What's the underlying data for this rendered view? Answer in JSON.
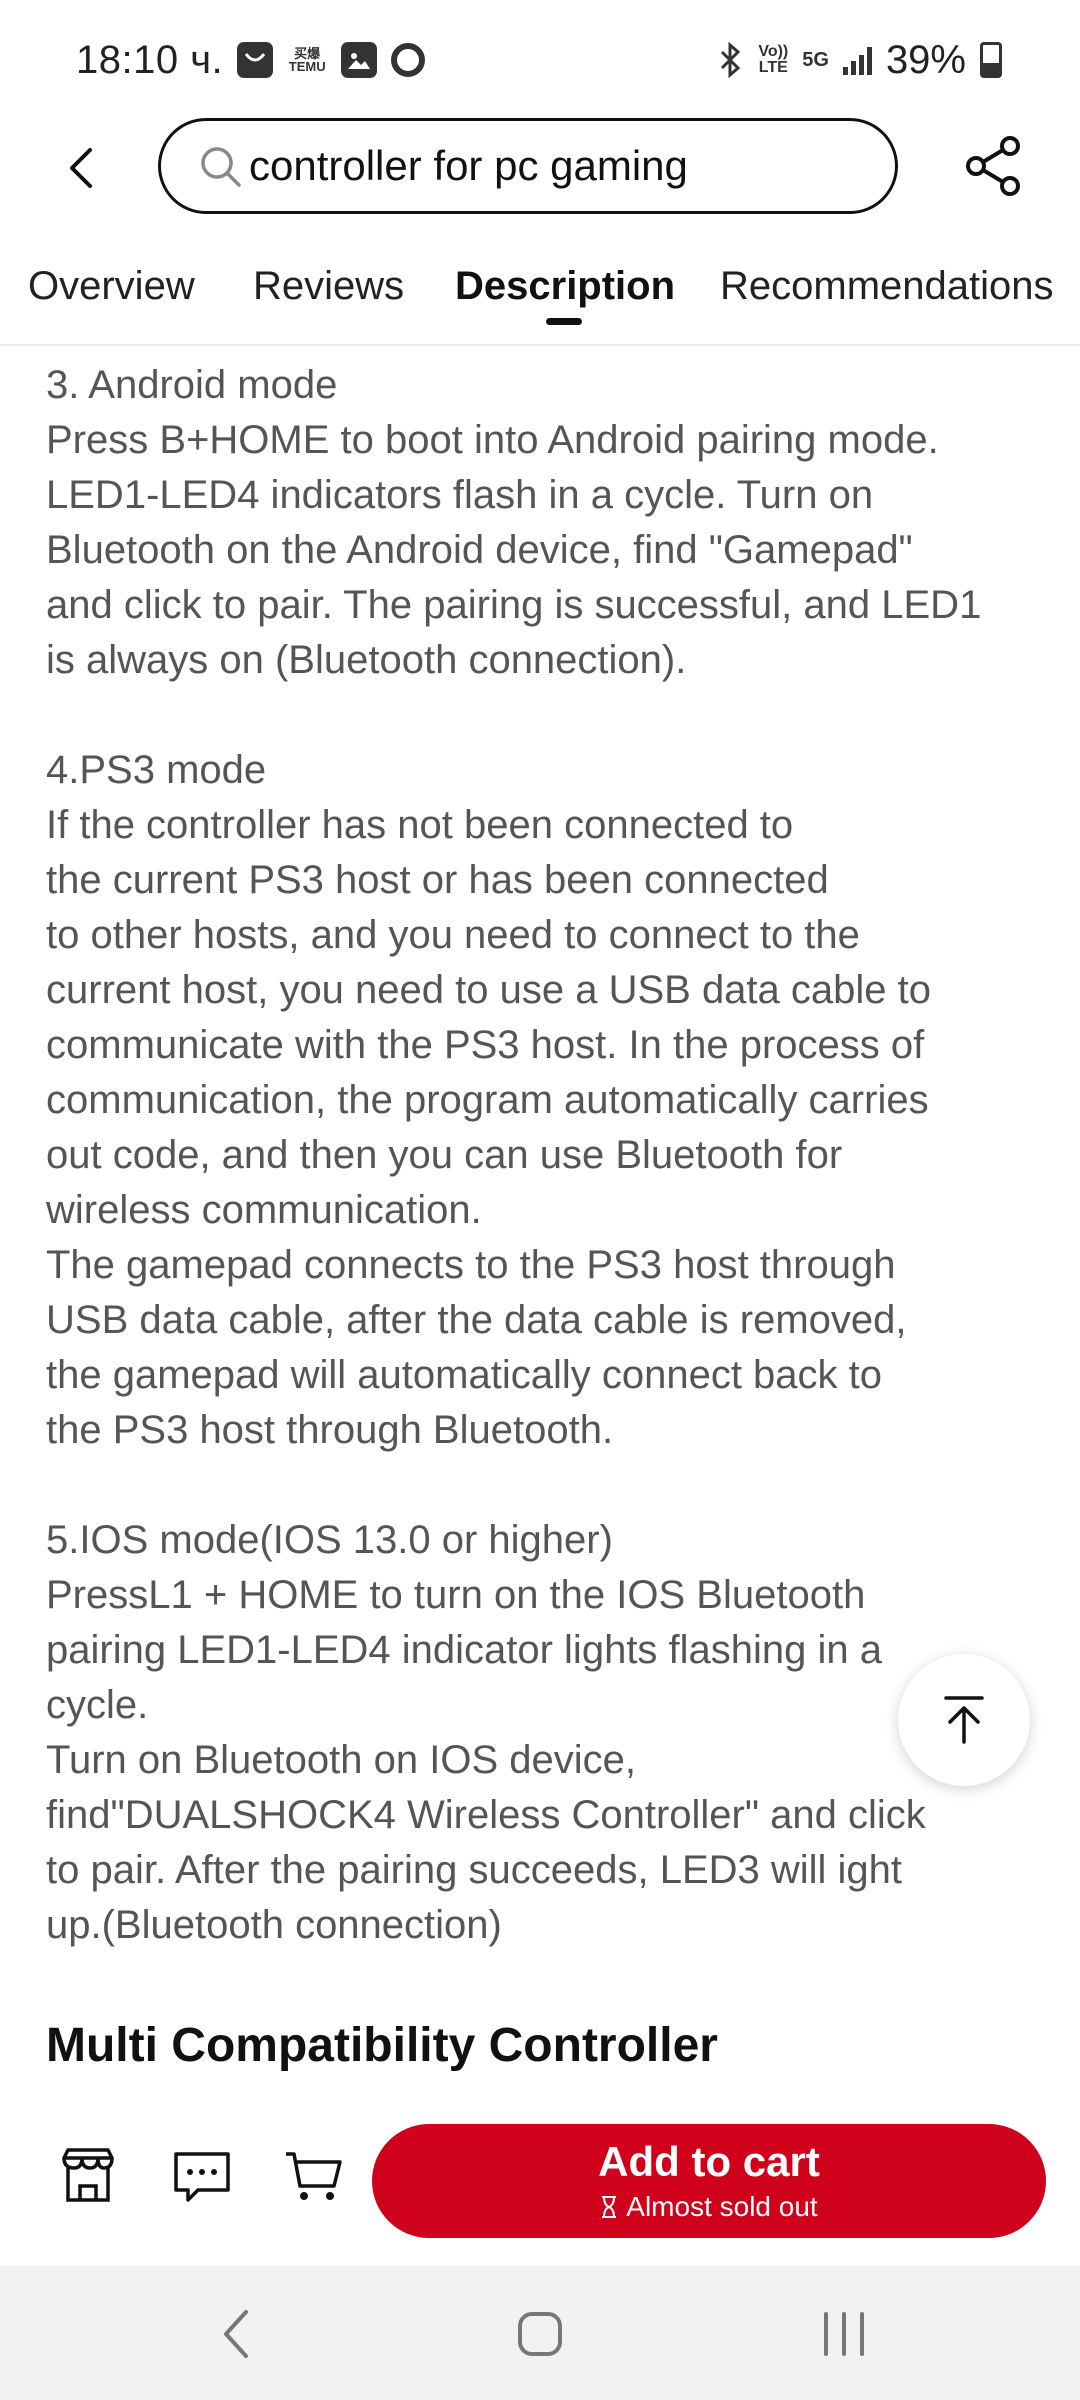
{
  "status_bar": {
    "time": "18:10 ч.",
    "temu_label": "买爆\nTEMU",
    "volte_label": "Vo))\nLTE",
    "network_label": "5G",
    "battery_percent": "39%"
  },
  "search": {
    "query": "controller for pc gaming"
  },
  "tabs": [
    {
      "label": "Overview"
    },
    {
      "label": "Reviews"
    },
    {
      "label": "Description"
    },
    {
      "label": "Recommendations"
    }
  ],
  "description": {
    "paragraphs": [
      "3. Android mode\nPress B+HOME to boot into Android pairing mode.\nLED1-LED4 indicators flash in a cycle. Turn on\nBluetooth on the Android device, find \"Gamepad\"\nand click to pair. The pairing is successful, and LED1\nis always on (Bluetooth connection).",
      "4.PS3 mode\nIf the controller has not been connected to\nthe current PS3 host or has been connected\nto other hosts, and you need to connect to the\ncurrent host, you need to use a USB data cable to\ncommunicate with the PS3 host. In the process of\ncommunication, the program automatically carries\nout code, and then you can use Bluetooth for\nwireless communication.\nThe gamepad connects to the PS3 host through\nUSB data cable, after the data cable is removed,\nthe gamepad will automatically connect back to\nthe PS3 host through Bluetooth.",
      "5.IOS mode(IOS 13.0 or higher)\nPressL1 + HOME to turn on the IOS Bluetooth\npairing LED1-LED4 indicator lights flashing in a\ncycle.\nTurn on Bluetooth on IOS device,\nfind\"DUALSHOCK4 Wireless Controller\" and click\nto pair. After the pairing succeeds, LED3 will ight\nup.(Bluetooth connection)"
    ],
    "section_heading": "Multi Compatibility Controller"
  },
  "bottom_bar": {
    "add_to_cart_label": "Add to cart",
    "stock_note": "Almost sold out",
    "brand_color": "#d0021b"
  },
  "icons": [
    "back-arrow-icon",
    "search-icon",
    "share-icon",
    "arrow-up-icon",
    "store-icon",
    "chat-icon",
    "cart-icon",
    "hourglass-icon",
    "nav-back-icon",
    "nav-home-icon",
    "nav-recents-icon"
  ]
}
